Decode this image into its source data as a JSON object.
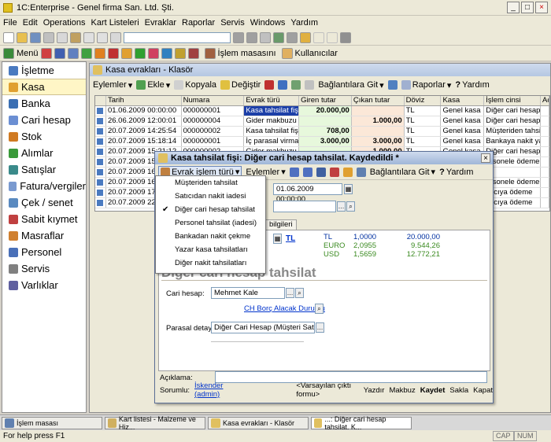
{
  "window": {
    "title": "1C:Enterprise - Genel firma San. Ltd. Şti.",
    "controls": [
      "_",
      "□",
      "×"
    ]
  },
  "menubar": [
    "File",
    "Edit",
    "Operations",
    "Kart Listeleri",
    "Evraklar",
    "Raporlar",
    "Servis",
    "Windows",
    "Yardım"
  ],
  "toolbar3": {
    "menu": "Menü",
    "cash": "İşlem masasını",
    "users": "Kullanıcılar"
  },
  "sidebar": [
    {
      "label": "İşletme",
      "color": "#4a7ac0"
    },
    {
      "label": "Kasa",
      "color": "#e0a030"
    },
    {
      "label": "Banka",
      "color": "#3b6fb3"
    },
    {
      "label": "Cari hesap",
      "color": "#6b8fd3"
    },
    {
      "label": "Stok",
      "color": "#d07a22"
    },
    {
      "label": "Alımlar",
      "color": "#3a9a3a"
    },
    {
      "label": "Satışlar",
      "color": "#3a8a8a"
    },
    {
      "label": "Fatura/vergiler",
      "color": "#7a9ad0"
    },
    {
      "label": "Çek / senet",
      "color": "#5a8ac0"
    },
    {
      "label": "Sabit kıymet",
      "color": "#c04040"
    },
    {
      "label": "Masraflar",
      "color": "#d08030"
    },
    {
      "label": "Personel",
      "color": "#4a70b8"
    },
    {
      "label": "Servis",
      "color": "#808080"
    },
    {
      "label": "Varlıklar",
      "color": "#6060a0"
    }
  ],
  "main": {
    "title": "Kasa evrakları - Klasör",
    "tools": [
      "Eylemler",
      "Ekle",
      "Kopyala",
      "Değiştir",
      "Bağlantılara Git",
      "Raporlar",
      "Yardım"
    ],
    "columns": [
      "Tarih",
      "Numara",
      "Evrak türü",
      "Giren tutar",
      "Çıkan tutar",
      "Döviz",
      "Kasa",
      "İşlem cinsi",
      "Ad"
    ],
    "rows": [
      [
        "01.06.2009 00:00:00",
        "000000001",
        "Kasa tahsilat fişi",
        "20.000,00",
        "",
        "TL",
        "Genel kasa",
        "Diğer cari hesap t"
      ],
      [
        "26.06.2009 12:00:01",
        "000000004",
        "Gider makbuzu",
        "",
        "1.000,00",
        "TL",
        "Genel kasa",
        "Diğer cari hesap t"
      ],
      [
        "20.07.2009 14:25:54",
        "000000002",
        "Kasa tahsilat fişi",
        "708,00",
        "",
        "TL",
        "Genel kasa",
        "Müşteriden tahsilat"
      ],
      [
        "20.07.2009 15:18:14",
        "000000001",
        "İç parasal virman...",
        "3.000,00",
        "3.000,00",
        "TL",
        "Genel kasa",
        "Bankaya nakit ya..."
      ],
      [
        "20.07.2009 15:21:12",
        "000000002",
        "Gider makbuzu",
        "",
        "1.000,00",
        "TL",
        "Genel kasa",
        "Diğer cari hesap t"
      ],
      [
        "20.07.2009 15:",
        "",
        "",
        "",
        "",
        "",
        "",
        "ersonele ödeme"
      ],
      [
        "20.07.2009 16:",
        "",
        "",
        "",
        "",
        "",
        "",
        ""
      ],
      [
        "20.07.2009 16:",
        "",
        "",
        "",
        "",
        "",
        "",
        "ersonele ödeme"
      ],
      [
        "20.07.2009 17:",
        "",
        "",
        "",
        "",
        "",
        "",
        "aticıya ödeme"
      ],
      [
        "20.07.2009 22:",
        "",
        "",
        "",
        "",
        "",
        "",
        "aticıya ödeme"
      ]
    ]
  },
  "dialog": {
    "title": "Kasa tahsilat fişi: Diğer cari hesap tahsilat. Kaydedildi *",
    "tools": [
      "Evrak işlem türü",
      "Eylemler",
      "Bağlantılara Git",
      "Yardım"
    ],
    "date_value": "01.06.2009 00:00:00",
    "tab_label": "bilgileri",
    "currency_link": "TL",
    "rates": [
      {
        "cur": "TL",
        "rate": "1,0000",
        "amount": "20.000,00"
      },
      {
        "cur": "EURO",
        "rate": "2,0955",
        "amount": "9.544,26"
      },
      {
        "cur": "USD",
        "rate": "1,5659",
        "amount": "12.772,21"
      }
    ],
    "big_title": "Diğer cari hesap tahsilat",
    "cari_label": "Cari hesap:",
    "cari_value": "Mehmet Kale",
    "balance_link": "CH Borç Alacak Durumu",
    "parasal_label": "Parasal detay:",
    "parasal_value": "Diğer Cari Hesap (Müşteri Satıcı haric",
    "aciklama_label": "Açıklama:",
    "sorumlu_label": "Sorumlu:",
    "sorumlu_value": "İskender (admin)",
    "footer_buttons": [
      "<Varsayılan çıktı formu>",
      "Yazdır",
      "Makbuz",
      "Kaydet",
      "Sakla",
      "Kapat"
    ]
  },
  "popup": {
    "items": [
      "Müşteriden tahsilat",
      "Satıcıdan nakit iadesi",
      "Diğer cari hesap tahsilat",
      "Personel tahsilat (iadesi)",
      "Bankadan nakit çekme",
      "Yazar kasa tahsilatları",
      "Diğer nakit tahsilatları"
    ],
    "checked_index": 2
  },
  "taskbar": [
    "İşlem masası",
    "Kart listesi - Malzeme ve Hiz...",
    "Kasa evrakları - Klasör",
    "...: Diğer cari hesap tahsilat. K..."
  ],
  "status": {
    "help": "For help press F1",
    "cap": "CAP",
    "num": "NUM"
  }
}
